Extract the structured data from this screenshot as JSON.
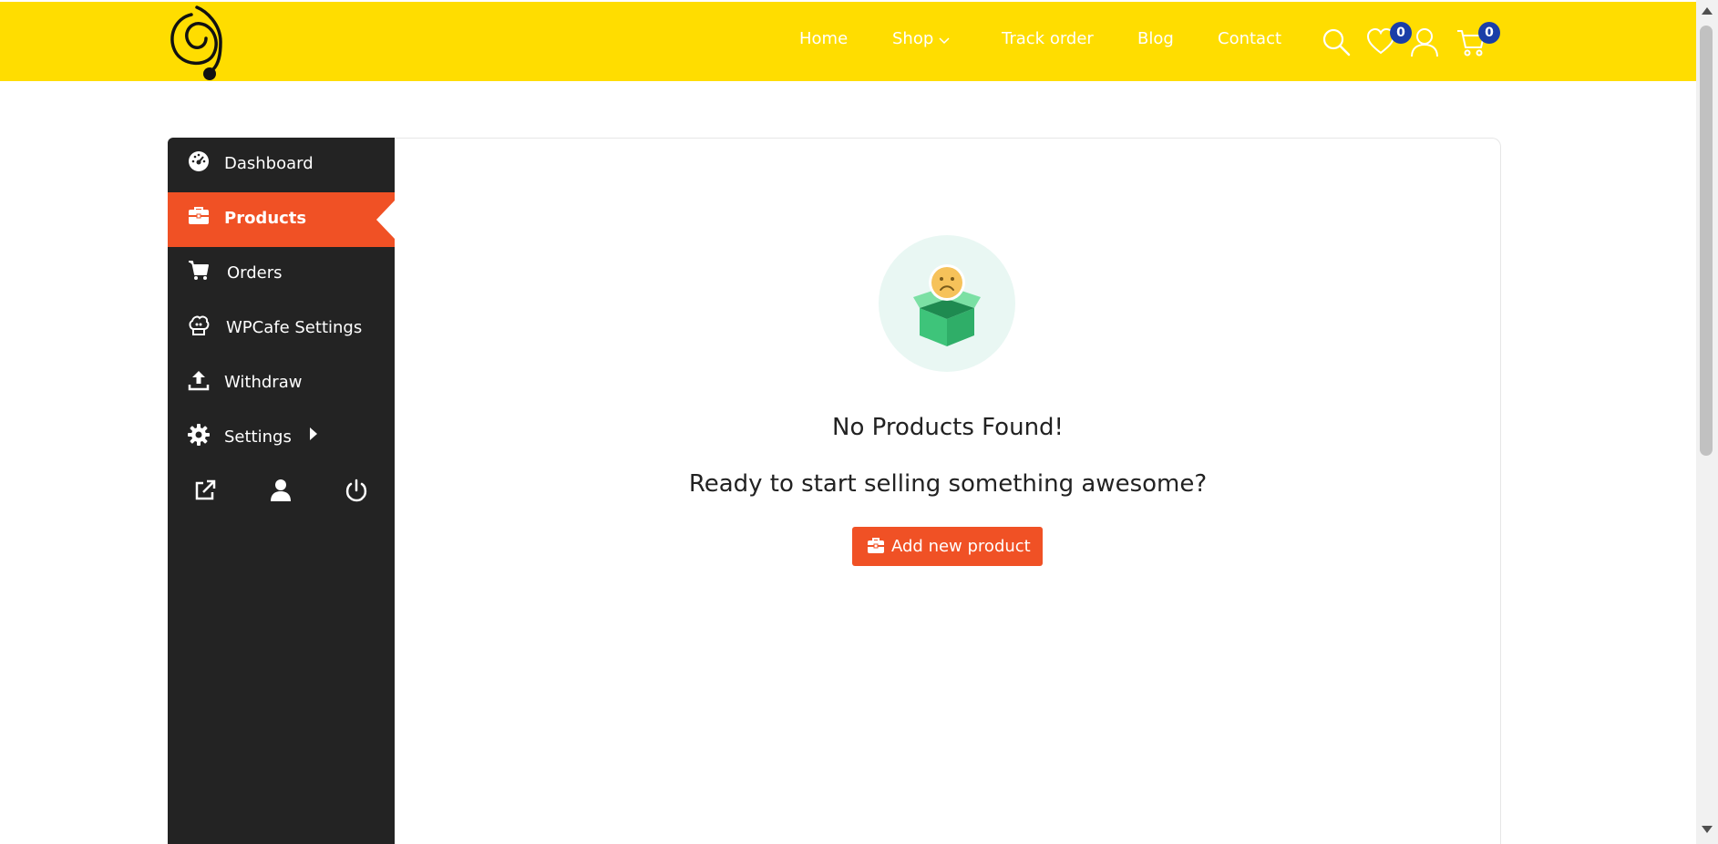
{
  "header": {
    "nav": {
      "home": "Home",
      "shop": "Shop",
      "track_order": "Track order",
      "blog": "Blog",
      "contact": "Contact"
    },
    "wishlist_count": "0",
    "cart_count": "0",
    "icons": [
      "logo",
      "search-icon",
      "heart-icon",
      "user-icon",
      "cart-icon"
    ],
    "colors": {
      "background": "#ffdd00",
      "badge": "#1a3ea8"
    }
  },
  "sidebar": {
    "items": [
      {
        "label": "Dashboard",
        "icon": "dashboard-icon"
      },
      {
        "label": "Products",
        "icon": "briefcase-icon",
        "active": true
      },
      {
        "label": "Orders",
        "icon": "cart-icon"
      },
      {
        "label": "WPCafe Settings",
        "icon": "chef-hat-icon"
      },
      {
        "label": "Withdraw",
        "icon": "upload-icon"
      },
      {
        "label": "Settings",
        "icon": "gear-icon"
      }
    ],
    "footer_icons": [
      "external-link-icon",
      "user-icon",
      "power-icon"
    ],
    "colors": {
      "background": "#232323",
      "active": "#f05125"
    }
  },
  "main": {
    "empty_title": "No Products Found!",
    "empty_subtitle": "Ready to start selling something awesome?",
    "add_button_label": "Add new product"
  }
}
